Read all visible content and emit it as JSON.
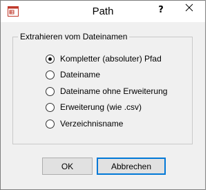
{
  "window": {
    "title": "Path",
    "help_glyph": "?",
    "icon": "app-window-icon"
  },
  "group": {
    "label": "Extrahieren vom Dateinamen",
    "options": [
      {
        "label": "Kompletter (absoluter) Pfad",
        "selected": true
      },
      {
        "label": "Dateiname",
        "selected": false
      },
      {
        "label": "Dateiname ohne Erweiterung",
        "selected": false
      },
      {
        "label": "Erweiterung (wie .csv)",
        "selected": false
      },
      {
        "label": "Verzeichnisname",
        "selected": false
      }
    ]
  },
  "buttons": {
    "ok_label": "OK",
    "cancel_label": "Abbrechen"
  },
  "colors": {
    "title_bar": "#ffffff",
    "dialog_bg": "#f0f0f0",
    "icon_accent": "#c0392b",
    "focus_border": "#0078d7"
  }
}
